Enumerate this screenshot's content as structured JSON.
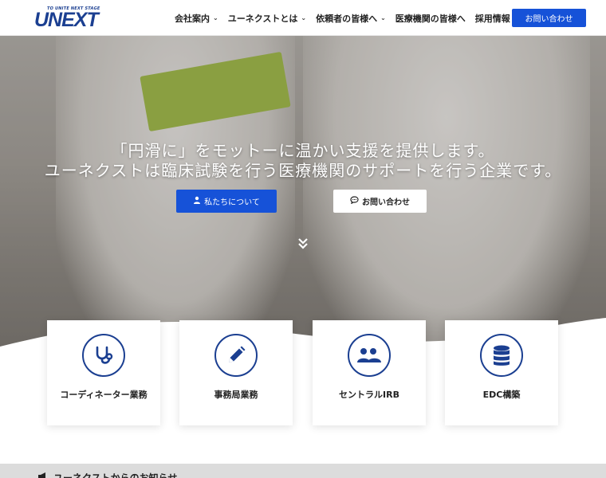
{
  "logo": {
    "tagline": "TO UNITE NEXT STAGE",
    "text": "UNEXT"
  },
  "nav": {
    "items": [
      {
        "label": "会社案内",
        "has_dropdown": true
      },
      {
        "label": "ユーネクストとは",
        "has_dropdown": true
      },
      {
        "label": "依頼者の皆様へ",
        "has_dropdown": true
      },
      {
        "label": "医療機関の皆様へ",
        "has_dropdown": false
      },
      {
        "label": "採用情報",
        "has_dropdown": true
      }
    ],
    "contact_label": "お問い合わせ"
  },
  "hero": {
    "line1": "「円滑に」をモットーに温かい支援を提供します。",
    "line2": "ユーネクストは臨床試験を行う医療機関のサポートを行う企業です。",
    "about_button": "私たちについて",
    "contact_button": "お問い合わせ"
  },
  "services": [
    {
      "title": "コーディネーター業務",
      "icon": "stethoscope-icon"
    },
    {
      "title": "事務局業務",
      "icon": "pencil-icon"
    },
    {
      "title": "セントラルIRB",
      "icon": "users-icon"
    },
    {
      "title": "EDC構築",
      "icon": "database-icon"
    }
  ],
  "news": {
    "title": "ユーネクストからのお知らせ"
  },
  "colors": {
    "brand_blue": "#1652d8",
    "logo_navy": "#1b3f91"
  }
}
